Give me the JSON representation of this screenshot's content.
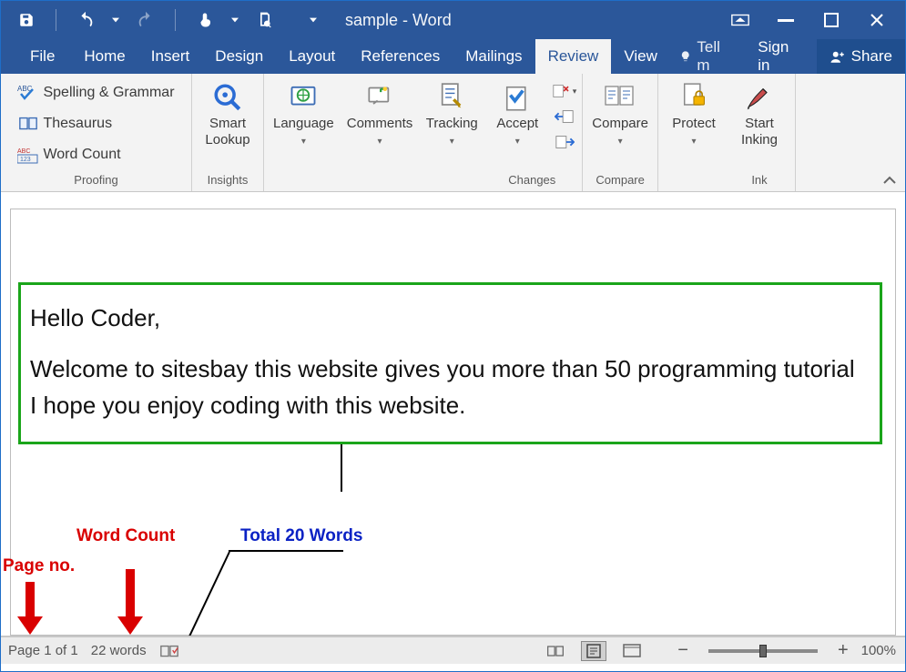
{
  "title": "sample - Word",
  "tabs": {
    "file": "File",
    "home": "Home",
    "insert": "Insert",
    "design": "Design",
    "layout": "Layout",
    "references": "References",
    "mailings": "Mailings",
    "review": "Review",
    "view": "View"
  },
  "tellme": "Tell m",
  "signin": "Sign in",
  "share": "Share",
  "ribbon": {
    "proofing": {
      "label": "Proofing",
      "spelling": "Spelling & Grammar",
      "thesaurus": "Thesaurus",
      "wordcount": "Word Count"
    },
    "insights": {
      "label": "Insights",
      "smart_lookup": "Smart\nLookup"
    },
    "language": {
      "label": "Language"
    },
    "comments": {
      "label": "Comments"
    },
    "tracking": {
      "label": "Tracking"
    },
    "changes": {
      "label": "Changes",
      "accept": "Accept"
    },
    "compare": {
      "label": "Compare",
      "compare_btn": "Compare"
    },
    "protect": {
      "label": "Protect"
    },
    "ink": {
      "label": "Ink",
      "start_inking": "Start\nInking"
    }
  },
  "document": {
    "line1": "Hello Coder,",
    "line2": "Welcome to sitesbay this website gives you more than 50 programming tutorial I hope you enjoy coding with this website."
  },
  "annot": {
    "page_no": "Page no.",
    "word_count": "Word Count",
    "total": "Total 20 Words"
  },
  "statusbar": {
    "page": "Page 1 of 1",
    "words": "22 words",
    "zoom": "100%"
  }
}
